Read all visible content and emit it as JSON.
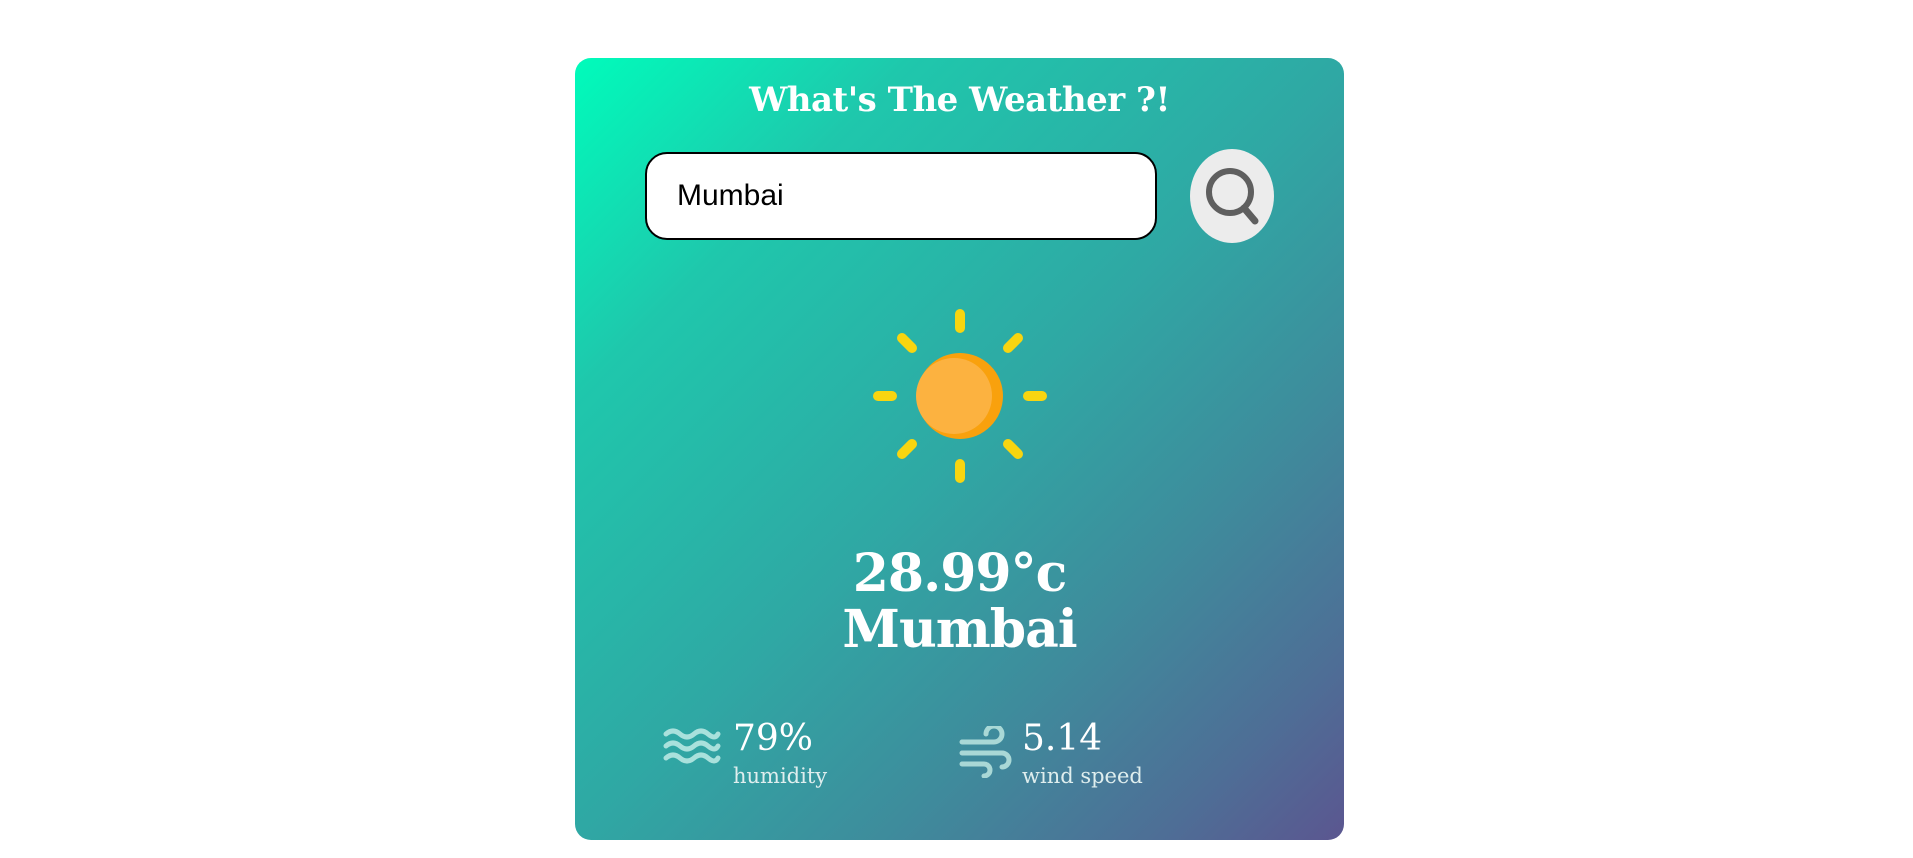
{
  "app": {
    "title": "What's The Weather ?!"
  },
  "search": {
    "value": "Mumbai",
    "placeholder": "",
    "button_icon": "search-icon"
  },
  "weather": {
    "icon": "sun-icon",
    "temperature": "28.99°c",
    "city": "Mumbai"
  },
  "details": {
    "humidity": {
      "icon": "humidity-waves-icon",
      "value": "79%",
      "label": "humidity"
    },
    "wind": {
      "icon": "wind-icon",
      "value": "5.14",
      "label": "wind speed"
    }
  },
  "colors": {
    "gradient_start": "#00fcbb",
    "gradient_end": "#5b5690",
    "sun_rays": "#f8d510",
    "sun_body": "#fcb240",
    "sun_shade": "#f9a10d",
    "text": "#ffffff"
  }
}
